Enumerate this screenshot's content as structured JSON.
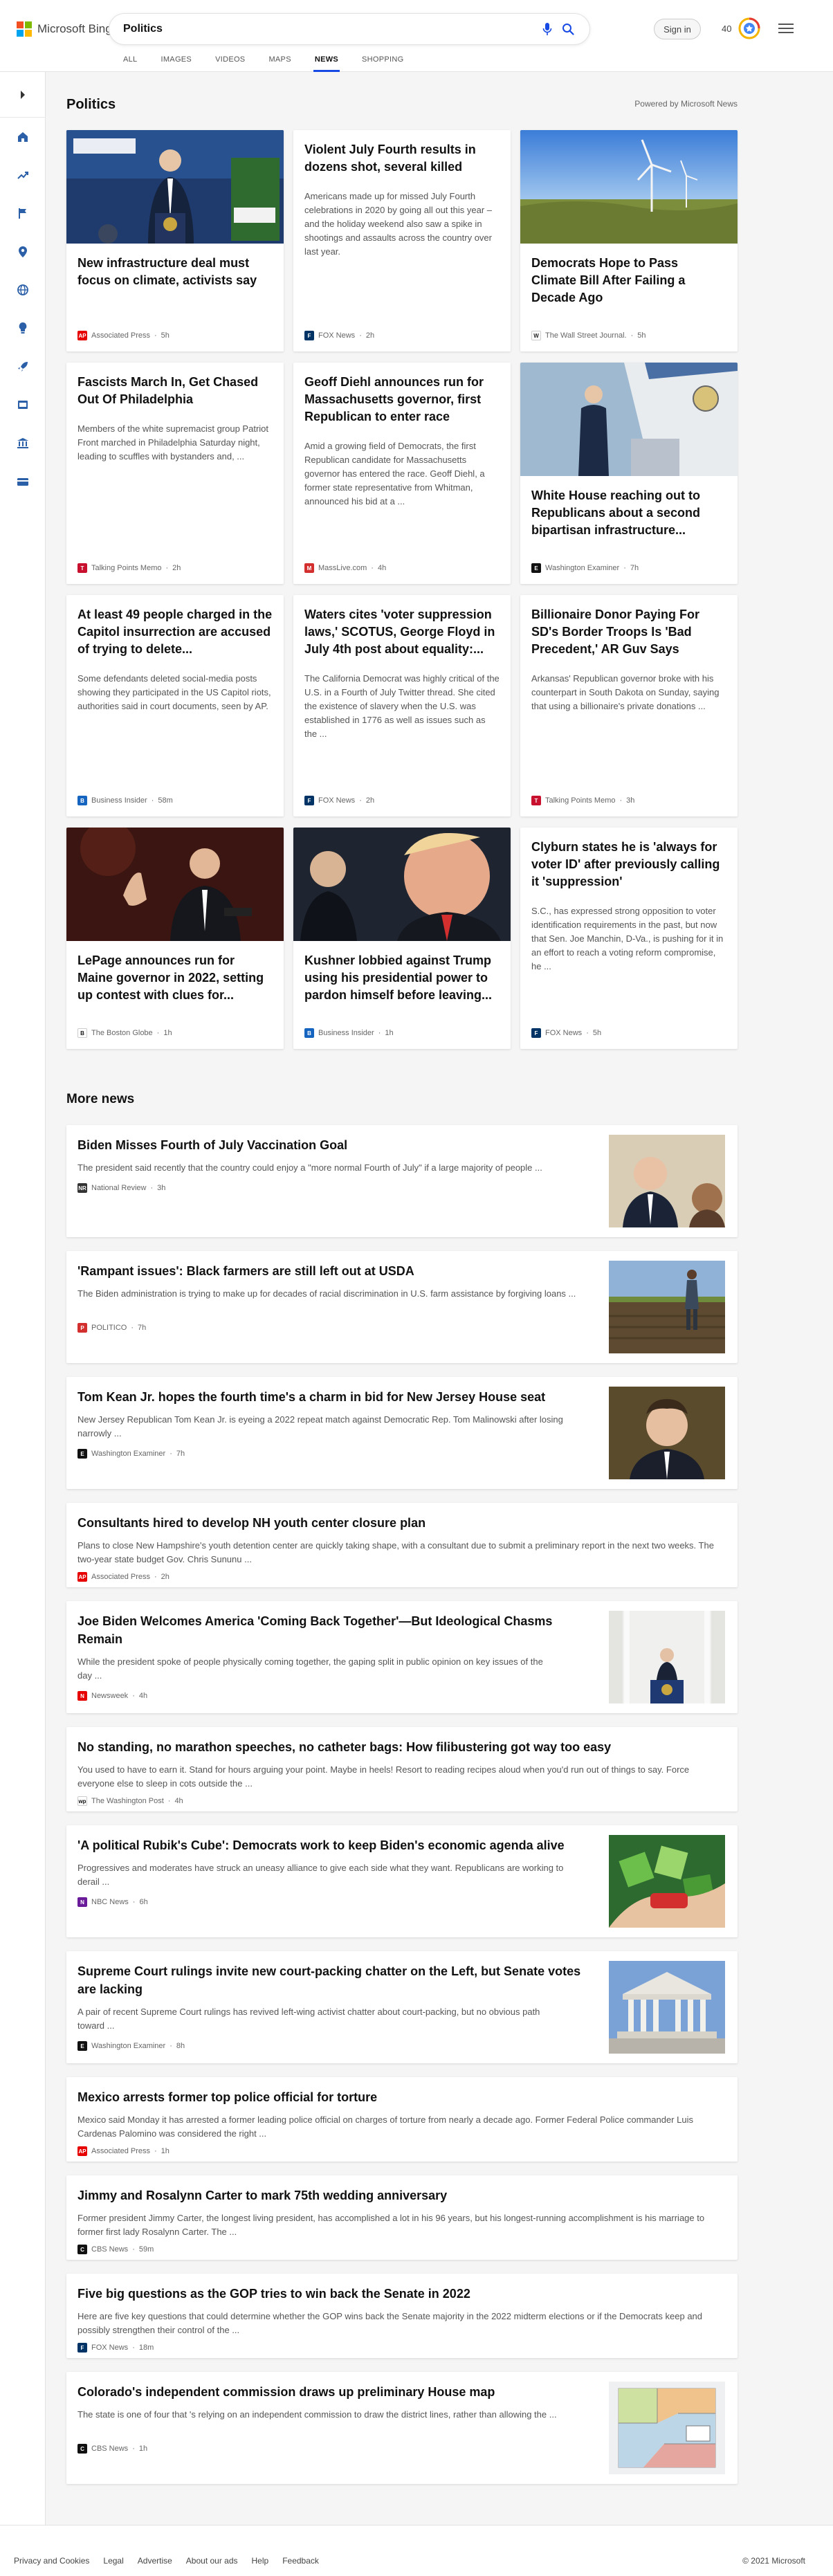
{
  "header": {
    "logo_text": "Microsoft Bing",
    "search_value": "Politics",
    "signin_label": "Sign in",
    "rewards_count": "40",
    "logo_colors": [
      "#f25022",
      "#7fba00",
      "#00a4ef",
      "#ffb900"
    ],
    "accent_color": "#174ae4",
    "icons": [
      "mic-icon",
      "search-icon",
      "rewards-icon",
      "hamburger-menu-icon"
    ]
  },
  "tabs": [
    {
      "label": "ALL",
      "active": false
    },
    {
      "label": "IMAGES",
      "active": false
    },
    {
      "label": "VIDEOS",
      "active": false
    },
    {
      "label": "MAPS",
      "active": false
    },
    {
      "label": "NEWS",
      "active": true
    },
    {
      "label": "SHOPPING",
      "active": false
    }
  ],
  "rail_icons": [
    "expand-icon",
    "home-icon",
    "trending-icon",
    "flag-icon",
    "location-icon",
    "globe-icon",
    "lightbulb-icon",
    "rocket-icon",
    "movie-icon",
    "bank-icon",
    "credit-card-icon"
  ],
  "main": {
    "section_title": "Politics",
    "powered_by": "Powered by Microsoft News",
    "cards": [
      {
        "title": "New infrastructure deal must focus on climate, activists say",
        "snippet": "",
        "source": "Associated Press",
        "age": "5h",
        "source_abbr": "AP",
        "source_color": "#e60000"
      },
      {
        "title": "Violent July Fourth results in dozens shot, several killed",
        "snippet": "Americans made up for missed July Fourth celebrations in 2020 by going all out this year – and the holiday weekend also saw a spike in shootings and assaults across the country over last year.",
        "source": "FOX News",
        "age": "2h",
        "source_abbr": "F",
        "source_color": "#003366"
      },
      {
        "title": "Democrats Hope to Pass Climate Bill After Failing a Decade Ago",
        "snippet": "",
        "source": "The Wall Street Journal.",
        "age": "5h",
        "source_abbr": "W",
        "source_color": "#222222"
      },
      {
        "title": "Fascists March In, Get Chased Out Of Philadelphia",
        "snippet": "Members of the white supremacist group Patriot Front marched in Philadelphia Saturday night, leading to scuffles with bystanders and, ...",
        "source": "Talking Points Memo",
        "age": "2h",
        "source_abbr": "T",
        "source_color": "#c8102e"
      },
      {
        "title": "Geoff Diehl announces run for Massachusetts governor, first Republican to enter race",
        "snippet": "Amid a growing field of Democrats, the first Republican candidate for Massachusetts governor has entered the race. Geoff Diehl, a former state representative from Whitman, announced his bid at a ...",
        "source": "MassLive.com",
        "age": "4h",
        "source_abbr": "M",
        "source_color": "#d32f2f"
      },
      {
        "title": "White House reaching out to Republicans about a second bipartisan infrastructure...",
        "snippet": "",
        "source": "Washington Examiner",
        "age": "7h",
        "source_abbr": "E",
        "source_color": "#111111"
      },
      {
        "title": "At least 49 people charged in the Capitol insurrection are accused of trying to delete...",
        "snippet": "Some defendants deleted social-media posts showing they participated in the US Capitol riots, authorities said in court documents, seen by AP.",
        "source": "Business Insider",
        "age": "58m",
        "source_abbr": "B",
        "source_color": "#1565c0"
      },
      {
        "title": "Waters cites 'voter suppression laws,' SCOTUS, George Floyd in July 4th post about equality:...",
        "snippet": "The California Democrat was highly critical of the U.S. in a Fourth of July Twitter thread. She cited the existence of slavery when the U.S. was established in 1776 as well as issues such as the ...",
        "source": "FOX News",
        "age": "2h",
        "source_abbr": "F",
        "source_color": "#003366"
      },
      {
        "title": "Billionaire Donor Paying For SD's Border Troops Is 'Bad Precedent,' AR Guv Says",
        "snippet": "Arkansas' Republican governor broke with his counterpart in South Dakota on Sunday, saying that using a billionaire's private donations ...",
        "source": "Talking Points Memo",
        "age": "3h",
        "source_abbr": "T",
        "source_color": "#c8102e"
      },
      {
        "title": "LePage announces run for Maine governor in 2022, setting up contest with clues for...",
        "snippet": "",
        "source": "The Boston Globe",
        "age": "1h",
        "source_abbr": "B",
        "source_color": "#111111"
      },
      {
        "title": "Kushner lobbied against Trump using his presidential power to pardon himself before leaving...",
        "snippet": "",
        "source": "Business Insider",
        "age": "1h",
        "source_abbr": "B",
        "source_color": "#1565c0"
      },
      {
        "title": "Clyburn states he is 'always for voter ID' after previously calling it 'suppression'",
        "snippet": "S.C., has expressed strong opposition to voter identification requirements in the past, but now that Sen. Joe Manchin, D-Va., is pushing for it in an effort to reach a voting reform compromise, he ...",
        "source": "FOX News",
        "age": "5h",
        "source_abbr": "F",
        "source_color": "#003366"
      }
    ]
  },
  "more_news": {
    "title": "More news",
    "items": [
      {
        "title": "Biden Misses Fourth of July Vaccination Goal",
        "snippet": "The president said recently that the country could enjoy a \"more normal Fourth of July\" if a large majority of people ...",
        "source": "National Review",
        "age": "3h",
        "source_abbr": "NR",
        "source_color": "#333333"
      },
      {
        "title": "'Rampant issues': Black farmers are still left out at USDA",
        "snippet": "The Biden administration is trying to make up for decades of racial discrimination in U.S. farm assistance by forgiving loans ...",
        "source": "POLITICO",
        "age": "7h",
        "source_abbr": "P",
        "source_color": "#d32f2f"
      },
      {
        "title": "Tom Kean Jr. hopes the fourth time's a charm in bid for New Jersey House seat",
        "snippet": "New Jersey Republican Tom Kean Jr. is eyeing a 2022 repeat match against Democratic Rep. Tom Malinowski after losing narrowly ...",
        "source": "Washington Examiner",
        "age": "7h",
        "source_abbr": "E",
        "source_color": "#111111"
      },
      {
        "title": "Consultants hired to develop NH youth center closure plan",
        "snippet": "Plans to close New Hampshire's youth detention center are quickly taking shape, with a consultant due to submit a preliminary report in the next two weeks. The two-year state budget Gov. Chris Sununu ...",
        "source": "Associated Press",
        "age": "2h",
        "source_abbr": "AP",
        "source_color": "#e60000"
      },
      {
        "title": "Joe Biden Welcomes America 'Coming Back Together'—But Ideological Chasms Remain",
        "snippet": "While the president spoke of people physically coming together, the gaping split in public opinion on key issues of the day ...",
        "source": "Newsweek",
        "age": "4h",
        "source_abbr": "N",
        "source_color": "#e60000"
      },
      {
        "title": "No standing, no marathon speeches, no catheter bags: How filibustering got way too easy",
        "snippet": "You used to have to earn it. Stand for hours arguing your point. Maybe in heels! Resort to reading recipes aloud when you'd run out of things to say. Force everyone else to sleep in cots outside the ...",
        "source": "The Washington Post",
        "age": "4h",
        "source_abbr": "wp",
        "source_color": "#111111"
      },
      {
        "title": "'A political Rubik's Cube': Democrats work to keep Biden's economic agenda alive",
        "snippet": "Progressives and moderates have struck an uneasy alliance to give each side what they want. Republicans are working to derail ...",
        "source": "NBC News",
        "age": "6h",
        "source_abbr": "N",
        "source_color": "#6a1b9a"
      },
      {
        "title": "Supreme Court rulings invite new court-packing chatter on the Left, but Senate votes are lacking",
        "snippet": "A pair of recent Supreme Court rulings has revived left-wing activist chatter about court-packing, but no obvious path toward ...",
        "source": "Washington Examiner",
        "age": "8h",
        "source_abbr": "E",
        "source_color": "#111111"
      },
      {
        "title": "Mexico arrests former top police official for torture",
        "snippet": "Mexico said Monday it has arrested a former leading police official on charges of torture from nearly a decade ago. Former Federal Police commander Luis Cardenas Palomino was considered the right ...",
        "source": "Associated Press",
        "age": "1h",
        "source_abbr": "AP",
        "source_color": "#e60000"
      },
      {
        "title": "Jimmy and Rosalynn Carter to mark 75th wedding anniversary",
        "snippet": "Former president Jimmy Carter, the longest living president, has accomplished a lot in his 96 years, but his longest-running accomplishment is his marriage to former first lady Rosalynn Carter. The ...",
        "source": "CBS News",
        "age": "59m",
        "source_abbr": "C",
        "source_color": "#111111"
      },
      {
        "title": "Five big questions as the GOP tries to win back the Senate in 2022",
        "snippet": "Here are five key questions that could determine whether the GOP wins back the Senate majority in the 2022 midterm elections or if the Democrats keep and possibly strengthen their control of the ...",
        "source": "FOX News",
        "age": "18m",
        "source_abbr": "F",
        "source_color": "#003366"
      },
      {
        "title": "Colorado's independent commission draws up preliminary House map",
        "snippet": "The state is one of four that 's relying on an independent commission to draw the district lines, rather than allowing the ...",
        "source": "CBS News",
        "age": "1h",
        "source_abbr": "C",
        "source_color": "#111111"
      }
    ]
  },
  "footer": {
    "links": [
      "Privacy and Cookies",
      "Legal",
      "Advertise",
      "About our ads",
      "Help",
      "Feedback"
    ],
    "copyright": "© 2021 Microsoft"
  }
}
